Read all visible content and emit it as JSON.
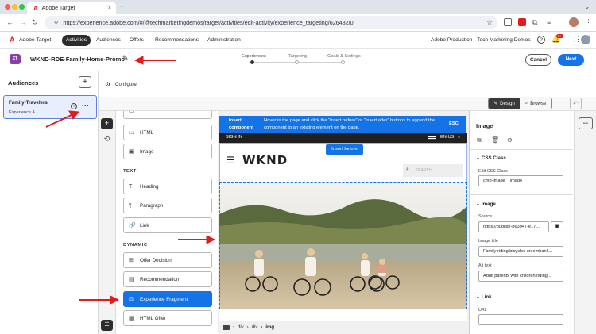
{
  "browser": {
    "tab_title": "Adobe Target",
    "url": "https://experience.adobe.com/#/@techmarketingdemos/target/activities/edit-activity/experience_targeting/626482/0"
  },
  "app": {
    "name": "Adobe Target",
    "nav": [
      "Activities",
      "Audiences",
      "Offers",
      "Recommendations",
      "Administration"
    ],
    "org": "Adobe Production - Tech Marketing Demos",
    "notification_count": "9+"
  },
  "activity": {
    "badge": "XT",
    "name": "WKND-RDE-Family-Home-Promo",
    "steps": [
      "Experiences",
      "Targeting",
      "Goals & Settings"
    ],
    "cancel_label": "Cancel",
    "next_label": "Next"
  },
  "audiences": {
    "title": "Audiences",
    "configure_label": "Configure",
    "card": {
      "name": "Family-Travelers",
      "experience": "Experience A"
    }
  },
  "components": {
    "items_top": [
      "HTML",
      "Image"
    ],
    "text_title": "TEXT",
    "text_items": [
      "Heading",
      "Paragraph",
      "Link"
    ],
    "dynamic_title": "DYNAMIC",
    "dynamic_items": [
      "Offer Decision",
      "Recommendation",
      "Experience Fragment",
      "HTML Offer"
    ]
  },
  "toolbar": {
    "design_label": "Design",
    "browse_label": "Browse"
  },
  "notice": {
    "title": "Insert component",
    "text": "Hover in the page and click the \"insert before\" or \"insert after\" buttons to append the component to an existing element on the page.",
    "esc": "ESC"
  },
  "site": {
    "sign_in": "SIGN IN",
    "lang": "EN-US",
    "logo": "WKND",
    "insert_before": "Insert before",
    "search_placeholder": "SEARCH"
  },
  "breadcrumb": [
    "div",
    "div",
    "img"
  ],
  "panel": {
    "title": "Image",
    "css_section": "CSS Class",
    "css_label": "Edit CSS Class",
    "css_value": "cmp-image__image",
    "image_section": "Image",
    "source_label": "Source",
    "source_value": "https://publish-p63947-e17...",
    "image_title_label": "Image title",
    "image_title_value": "Family riding bicycles on embank...",
    "alt_label": "Alt text",
    "alt_value": "Adult parents with children riding...",
    "link_section": "Link",
    "url_label": "URL",
    "url_value": ""
  }
}
